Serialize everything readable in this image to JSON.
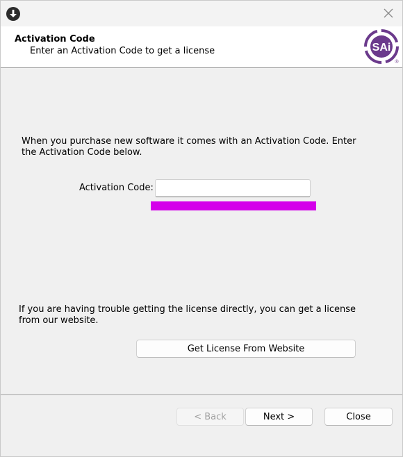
{
  "window": {
    "icon": "download-circle-icon",
    "close_icon": "close-icon"
  },
  "header": {
    "title": "Activation Code",
    "subtitle": "Enter an Activation Code to get a license",
    "logo_text": "SAi",
    "logo_color": "#6b3a8c"
  },
  "main": {
    "intro_text": "When you purchase new software it comes with an Activation Code.  Enter the Activation Code below.",
    "activation_code_label": "Activation Code:",
    "activation_code_value": "",
    "highlight_color": "#d400ea",
    "trouble_text": "If you are having trouble getting the license directly, you can get a license from our website.",
    "website_button_label": "Get License From Website"
  },
  "footer": {
    "back_label": "< Back",
    "next_label": "Next >",
    "close_label": "Close"
  }
}
